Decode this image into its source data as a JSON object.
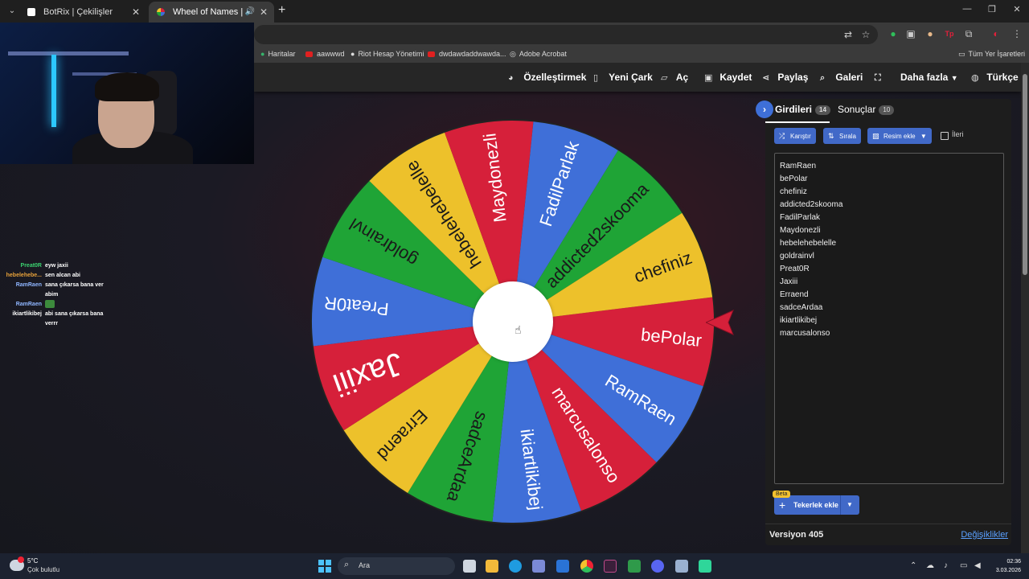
{
  "browser": {
    "tabs": [
      {
        "title": "BotRix | Çekilişler"
      },
      {
        "title": "Wheel of Names | Rastgele"
      }
    ],
    "bookmarks": [
      "Haritalar",
      "aawwwd",
      "Riot Hesap Yönetimi",
      "dwdawdaddwawda...",
      "Adobe Acrobat"
    ],
    "all_bookmarks": "Tüm Yer İşaretleri"
  },
  "chat": [
    {
      "name": "Preat0R",
      "color": "#3bd16f",
      "lines": [
        "eyw jaxii"
      ]
    },
    {
      "name": "hebelehebe...",
      "color": "#e8a23a",
      "lines": [
        "sen alcan abi"
      ]
    },
    {
      "name": "RamRaen",
      "color": "#8fb6ff",
      "lines": [
        "sana çıkarsa bana ver",
        "abim"
      ]
    },
    {
      "name": "RamRaen",
      "color": "#8fb6ff",
      "lines": [
        ""
      ]
    },
    {
      "name": "ikiartlikibej",
      "color": "#ffffff",
      "lines": [
        "abi sana çıkarsa bana",
        "verrr"
      ]
    }
  ],
  "navbar": {
    "customize": "Özelleştirmek",
    "new_wheel": "Yeni Çark",
    "open": "Aç",
    "save": "Kaydet",
    "share": "Paylaş",
    "gallery": "Galeri",
    "more": "Daha fazla",
    "language": "Türkçe"
  },
  "wheel": {
    "colors": [
      "#d6203a",
      "#3f6fd8",
      "#1fa436",
      "#edc12b"
    ],
    "segments": [
      {
        "label": "bePolar",
        "color": "#d6203a"
      },
      {
        "label": "RamRaen",
        "color": "#3f6fd8"
      },
      {
        "label": "marcusalonso",
        "color": "#d6203a"
      },
      {
        "label": "ikiartlikibej",
        "color": "#3f6fd8"
      },
      {
        "label": "sadceArdaa",
        "color": "#1fa436"
      },
      {
        "label": "Erraend",
        "color": "#edc12b"
      },
      {
        "label": "Jaxiii",
        "color": "#d6203a"
      },
      {
        "label": "Preat0R",
        "color": "#3f6fd8"
      },
      {
        "label": "goldrainvl",
        "color": "#1fa436"
      },
      {
        "label": "hebelehebelelle",
        "color": "#edc12b"
      },
      {
        "label": "Maydonezli",
        "color": "#d6203a"
      },
      {
        "label": "FadilParlak",
        "color": "#3f6fd8"
      },
      {
        "label": "addicted2skooma",
        "color": "#1fa436"
      },
      {
        "label": "chefiniz",
        "color": "#edc12b"
      }
    ]
  },
  "panel": {
    "entries_tab": "Girdileri",
    "entries_count": "14",
    "results_tab": "Sonuçlar",
    "results_count": "10",
    "shuffle": "Karıştır",
    "sort": "Sırala",
    "add_image": "Resim ekle",
    "advanced": "İleri",
    "entries": [
      "RamRaen",
      "bePolar",
      "chefiniz",
      "addicted2skooma",
      "FadilParlak",
      "Maydonezli",
      "hebelehebelelle",
      "goldrainvl",
      "Preat0R",
      "Jaxiii",
      "Erraend",
      "sadceArdaa",
      "ikiartlikibej",
      "marcusalonso"
    ],
    "beta": "Beta",
    "add_images": "Tekerlek ekle",
    "version": "Versiyon 405",
    "changes": "Değişiklikler"
  },
  "taskbar": {
    "temp": "5°C",
    "weather": "Çok bulutlu",
    "search": "Ara",
    "time": "02:36",
    "date": "3.03.2026"
  }
}
